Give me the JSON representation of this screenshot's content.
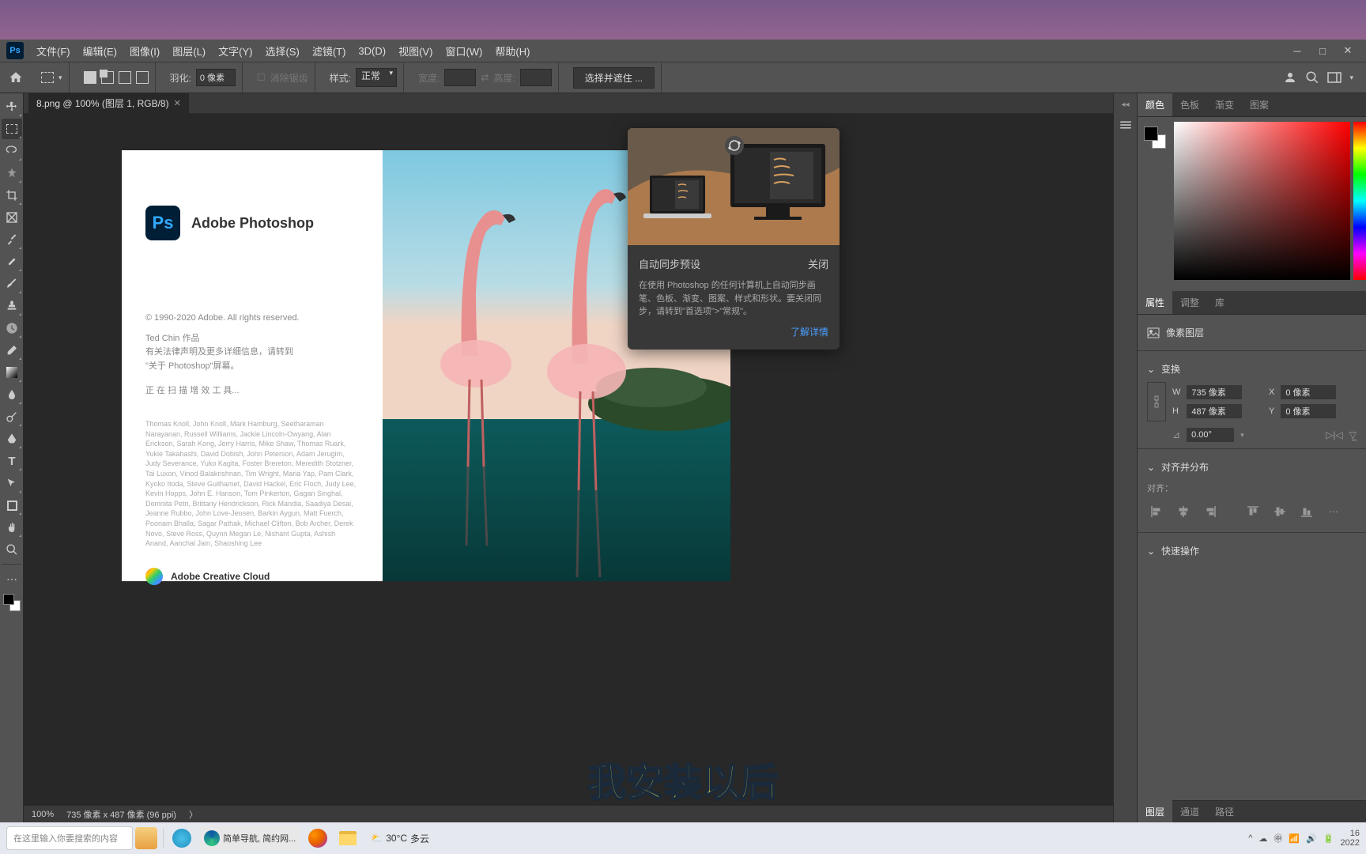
{
  "menubar": {
    "items": [
      "文件(F)",
      "编辑(E)",
      "图像(I)",
      "图层(L)",
      "文字(Y)",
      "选择(S)",
      "滤镜(T)",
      "3D(D)",
      "视图(V)",
      "窗口(W)",
      "帮助(H)"
    ]
  },
  "options": {
    "feather_label": "羽化:",
    "feather_value": "0 像素",
    "antialias": "消除锯齿",
    "style_label": "样式:",
    "style_value": "正常",
    "width_label": "宽度:",
    "height_label": "高度:",
    "select_mask": "选择并遮住 ..."
  },
  "doc": {
    "tab_title": "8.png @ 100% (图层 1, RGB/8)",
    "zoom": "100%",
    "status": "735 像素 x 487 像素 (96 ppi)"
  },
  "splash": {
    "title": "Adobe Photoshop",
    "copyright": "© 1990-2020 Adobe. All rights reserved.",
    "artwork": "Ted Chin 作品",
    "legal1": "有关法律声明及更多详细信息，请转到",
    "legal2": "\"关于  Photoshop\"屏幕。",
    "loading": "正 在 扫 描 增 效 工 具...",
    "credits": "Thomas Knoll, John Knoll, Mark Hamburg, Seetharaman Narayanan, Russell Williams, Jackie Lincoln-Owyang, Alan Erickson, Sarah Kong, Jerry Harris, Mike Shaw, Thomas Ruark, Yukie Takahashi, David Dobish, John Peterson, Adam Jerugim, Judy Severance, Yuko Kagita, Foster Brereton, Meredith Stotzner, Tai Luxon, Vinod Balakrishnan, Tim Wright, Maria Yap, Pam Clark, Kyoko Itoda, Steve Guilhamet, David Hackel, Eric Floch, Judy Lee, Kevin Hopps, John E. Hanson, Tom Pinkerton, Gagan Singhal, Domnita Petri, Brittany Hendrickson, Rick Mandia, Saadiya Desai, Jeanne Rubbo, John Love-Jensen, Barkin Aygun, Matt Fuerch, Poonam Bhalla, Sagar Pathak, Michael Clifton, Bob Archer, Derek Novo, Steve Ross, Quynn Megan Le, Nishant Gupta, Ashish Anand, Aanchal Jain, Shaoshing Lee",
    "cc_label": "Adobe Creative Cloud"
  },
  "sync": {
    "title": "自动同步预设",
    "close": "关闭",
    "desc": "在使用 Photoshop 的任何计算机上自动同步画笔、色板、渐变、图案、样式和形状。要关闭同步，请转到\"首选项\">\"常规\"。",
    "link": "了解详情"
  },
  "subtitle": "我安装以后",
  "panels": {
    "color_tabs": [
      "颜色",
      "色板",
      "渐变",
      "图案"
    ],
    "props_tabs": [
      "属性",
      "调整",
      "库"
    ],
    "props_title": "像素图层",
    "transform_label": "变换",
    "w_label": "W",
    "w_value": "735 像素",
    "x_label": "X",
    "x_value": "0 像素",
    "h_label": "H",
    "h_value": "487 像素",
    "y_label": "Y",
    "y_value": "0 像素",
    "angle_value": "0.00°",
    "align_label": "对齐并分布",
    "align_sublabel": "对齐：",
    "quick_label": "快速操作",
    "layers_tabs": [
      "图层",
      "通道",
      "路径"
    ]
  },
  "taskbar": {
    "search_placeholder": "在这里输入你要搜索的内容",
    "browser_tab": "简单导航, 简约网...",
    "weather_temp": "30°C",
    "weather_desc": "多云",
    "time": "16",
    "date": "2022"
  }
}
